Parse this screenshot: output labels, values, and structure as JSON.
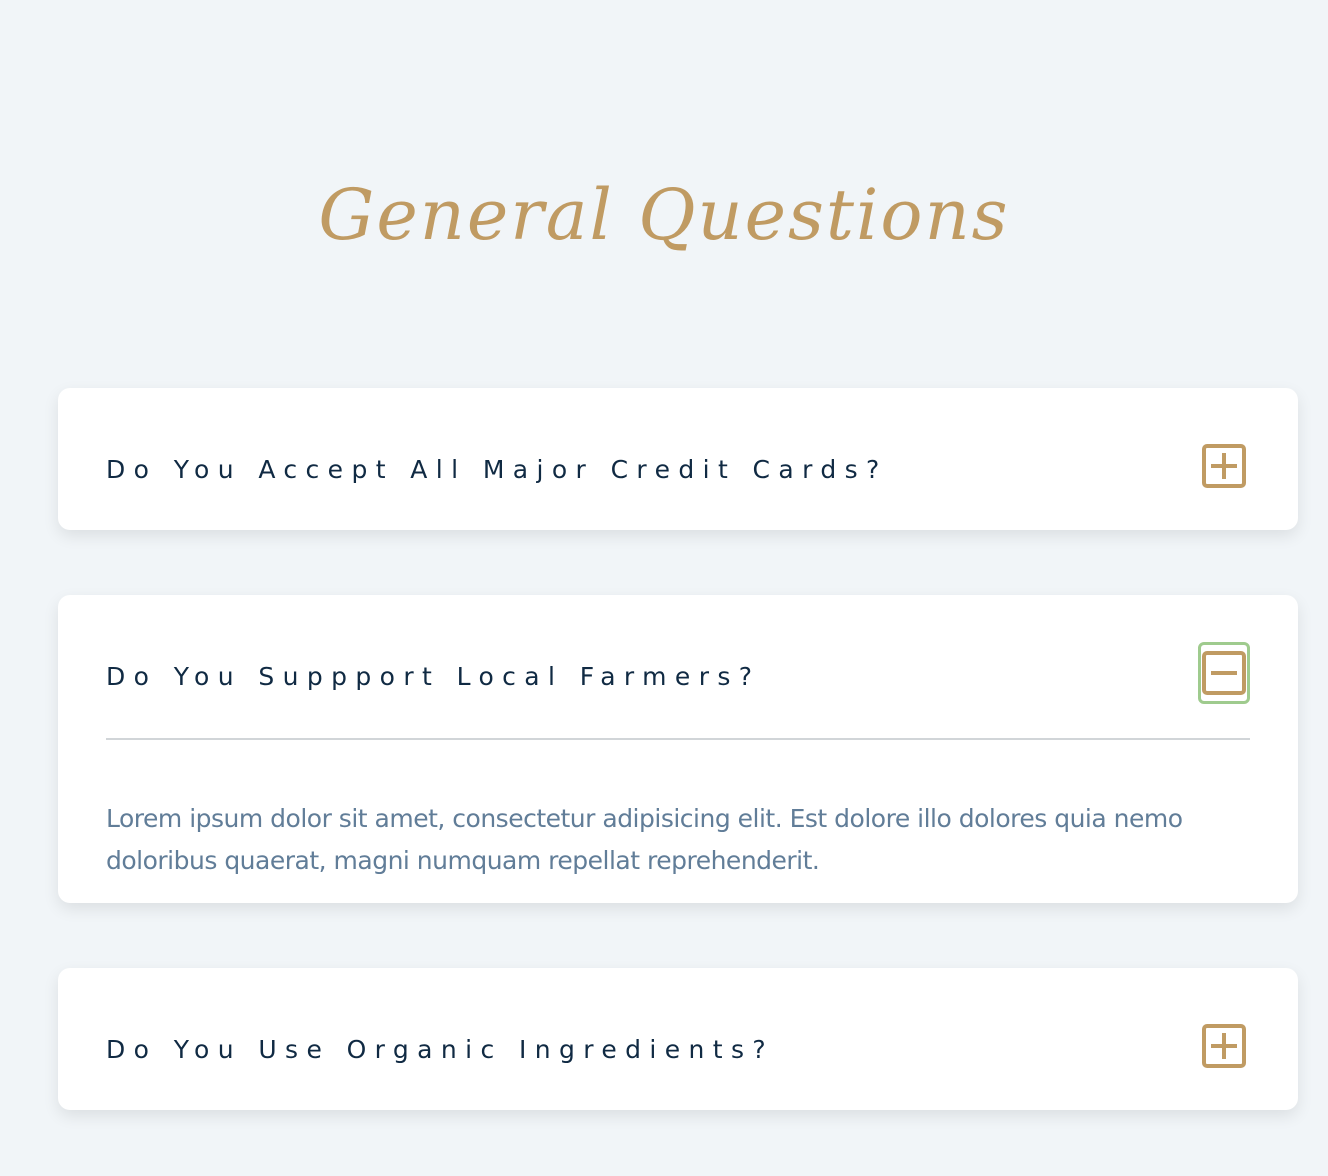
{
  "heading": "General Questions",
  "faqs": [
    {
      "question": "Do You Accept All Major Credit Cards?",
      "expanded": false,
      "toggle_icon": "plus-square-icon"
    },
    {
      "question": "Do You Suppport Local Farmers?",
      "expanded": true,
      "toggle_icon": "minus-square-icon",
      "answer": "Lorem ipsum dolor sit amet, consectetur adipisicing elit. Est dolore illo dolores quia nemo doloribus quaerat, magni numquam repellat reprehenderit."
    },
    {
      "question": "Do You Use Organic Ingredients?",
      "expanded": false,
      "toggle_icon": "plus-square-icon"
    }
  ],
  "colors": {
    "background": "#f1f5f8",
    "accent": "#c09b63",
    "question_text": "#102a43",
    "answer_text": "#617d98",
    "focus_ring": "#9fcb8e"
  }
}
